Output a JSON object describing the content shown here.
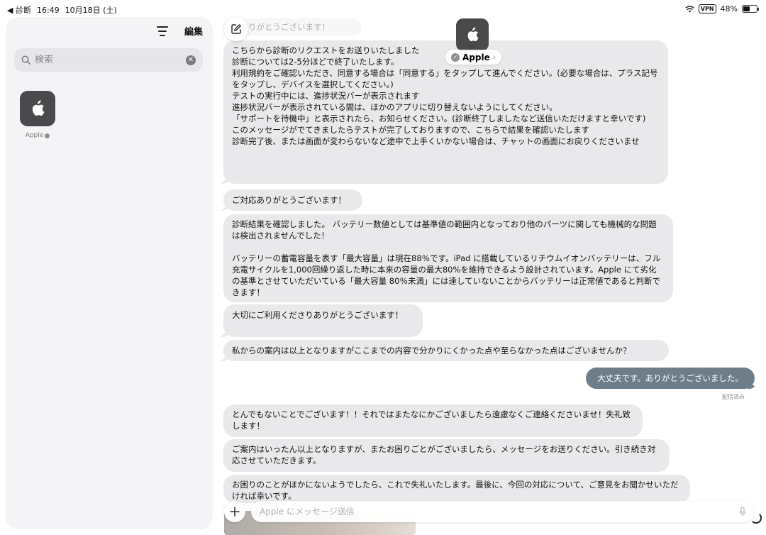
{
  "status_bar": {
    "back_label": "◀ 診断",
    "time": "16:49",
    "date": "10月18日 (土)",
    "vpn": "VPN",
    "battery": "48%",
    "battery_level": 0.48
  },
  "sidebar": {
    "edit_label": "編集",
    "search_placeholder": "検索",
    "conversations": [
      {
        "name": "Apple"
      }
    ]
  },
  "chat": {
    "contact_name": "Apple",
    "messages": [
      {
        "from": "them",
        "text": "力ありがとうございます！"
      },
      {
        "from": "them",
        "text": "こちらから診断のリクエストをお送りいたしました\n診断については2-5分ほどで終了いたします。\n利用規約をご確認いただき、同意する場合は「同意する」をタップして進んでください。(必要な場合は、プラス記号をタップし、デバイスを選択してください。)\nテストの実行中には、進捗状況バーが表示されます\n進捗状況バーが表示されている間は、ほかのアプリに切り替えないようにしてください。\n「サポートを待機中」と表示されたら、お知らせください。(診断終了しましたなど送信いただけますと幸いです)\nこのメッセージがでてきましたらテストが完了しておりますので、こちらで結果を確認いたします\n診断完了後、または画面が変わらないなど途中で上手くいかない場合は、チャットの画面にお戻りくださいませ"
      },
      {
        "from": "them",
        "text": "ご対応ありがとうございます！"
      },
      {
        "from": "them",
        "text": "診断結果を確認しました。 バッテリー数値としては基準値の範囲内となっており他のパーツに関しても機械的な問題は検出されませんでした！\n\nバッテリーの蓄電容量を表す「最大容量」は現在88％です。iPad に搭載しているリチウムイオンバッテリーは、フル充電サイクルを1,000回繰り返した時に本来の容量の最大80%を維持できるよう設計されています。Apple にて劣化の基準とさせていただいている「最大容量 80％未満」には達していないことからバッテリーは正常値であると判断できます！"
      },
      {
        "from": "them",
        "text": "大切にご利用くださりありがとうございます！"
      },
      {
        "from": "them",
        "text": "私からの案内は以上となりますがここまでの内容で分かりにくかった点や至らなかった点はございませんか？"
      },
      {
        "from": "me",
        "text": "大丈夫です。ありがとうございました。"
      },
      {
        "from": "them",
        "text": "とんでもないことでございます！！それではまたなにかございましたら遠慮なくご連絡くださいませ！失礼致します！"
      },
      {
        "from": "them",
        "text": "ご案内はいったん以上となりますが、またお困りごとがございましたら、メッセージをお送りください。引き続き対応させていただきます。"
      },
      {
        "from": "them",
        "text": "お困りのことがほかにないようでしたら、これで失礼いたします。最後に、今回の対応について、ご意見をお聞かせいただければ幸いです。"
      }
    ],
    "delivered_label": "配信済み",
    "input_placeholder": "Apple にメッセージ送信"
  }
}
